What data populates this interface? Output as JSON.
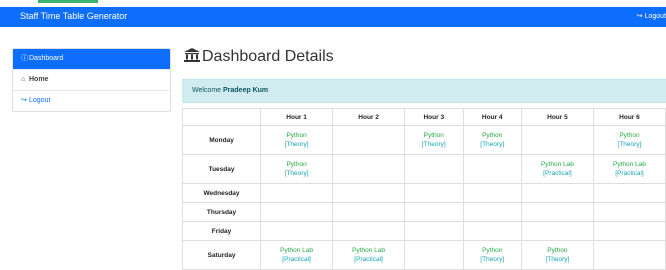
{
  "navbar": {
    "brand": "Staff Time Table Generator",
    "logout_label": "Logout",
    "logout_icon": "sign-out-icon",
    "color": "#0d6efd"
  },
  "sidebar": {
    "items": [
      {
        "label": "Dashboard",
        "icon": "info-circle-icon",
        "active": true
      },
      {
        "label": "Home",
        "icon": "home-icon",
        "active": false
      },
      {
        "label": "Logout",
        "icon": "sign-out-icon",
        "active": false
      }
    ]
  },
  "main": {
    "title": "Dashboard Details",
    "title_icon": "bank-icon",
    "welcome_prefix": "Welcome",
    "user_name": "Pradeep Kum"
  },
  "timetable": {
    "hours": [
      "Hour 1",
      "Hour 2",
      "Hour 3",
      "Hour 4",
      "Hour 5",
      "Hour 6"
    ],
    "rows": [
      {
        "day": "Monday",
        "cells": [
          {
            "subject": "Python",
            "type": "[Theory]"
          },
          null,
          {
            "subject": "Python",
            "type": "[Theory]"
          },
          {
            "subject": "Python",
            "type": "[Theory]"
          },
          null,
          {
            "subject": "Python",
            "type": "[Theory]"
          }
        ]
      },
      {
        "day": "Tuesday",
        "cells": [
          {
            "subject": "Python",
            "type": "[Theory]"
          },
          null,
          null,
          null,
          {
            "subject": "Python Lab",
            "type": "[Practical]"
          },
          {
            "subject": "Python Lab",
            "type": "[Practical]"
          }
        ]
      },
      {
        "day": "Wednesday",
        "cells": [
          null,
          null,
          null,
          null,
          null,
          null
        ]
      },
      {
        "day": "Thursday",
        "cells": [
          null,
          null,
          null,
          null,
          null,
          null
        ]
      },
      {
        "day": "Friday",
        "cells": [
          null,
          null,
          null,
          null,
          null,
          null
        ]
      },
      {
        "day": "Saturday",
        "cells": [
          {
            "subject": "Python Lab",
            "type": "[Practical]"
          },
          {
            "subject": "Python Lab",
            "type": "[Practical]"
          },
          null,
          {
            "subject": "Python",
            "type": "[Theory]"
          },
          {
            "subject": "Python",
            "type": "[Theory]"
          },
          null
        ]
      }
    ]
  }
}
